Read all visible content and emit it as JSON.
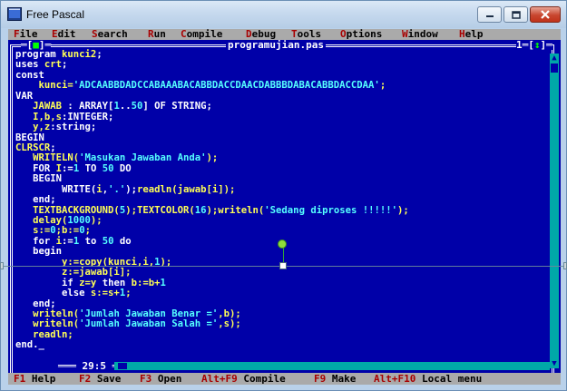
{
  "window": {
    "title": "Free Pascal",
    "icon": "free-pascal-icon",
    "colors": {
      "frame": "#b9d1ea",
      "desktop": "#0000a8",
      "menu": "#aaaaaa",
      "hotkey": "#a80000"
    }
  },
  "menu": [
    {
      "hot": "F",
      "rest": "ile"
    },
    {
      "hot": "E",
      "rest": "dit"
    },
    {
      "hot": "S",
      "rest": "earch"
    },
    {
      "hot": "R",
      "rest": "un"
    },
    {
      "hot": "C",
      "rest": "ompile"
    },
    {
      "hot": "D",
      "rest": "ebug"
    },
    {
      "hot": "T",
      "rest": "ools"
    },
    {
      "hot": "O",
      "rest": "ptions"
    },
    {
      "hot": "W",
      "rest": "indow"
    },
    {
      "hot": "H",
      "rest": "elp"
    }
  ],
  "editor": {
    "close_left": "═[",
    "close_mark": "■",
    "close_right": "]═",
    "filename": "programujian.pas",
    "window_number_left": "1═[",
    "window_number_mark": "↕",
    "window_number_right": "]═",
    "cursor_position": "29:5",
    "code": [
      [
        {
          "t": "program ",
          "c": "kw"
        },
        {
          "t": "kunci2",
          "c": "id"
        },
        {
          "t": ";",
          "c": "kw"
        }
      ],
      [
        {
          "t": "uses ",
          "c": "kw"
        },
        {
          "t": "crt",
          "c": "id"
        },
        {
          "t": ";",
          "c": "kw"
        }
      ],
      [
        {
          "t": "const",
          "c": "kw"
        }
      ],
      [
        {
          "t": "    kunci=",
          "c": "id"
        },
        {
          "t": "'ADCAABBDADCCABAAABACABBDACCDAACDABBBDABACABBDACCDAA'",
          "c": "str"
        },
        {
          "t": ";",
          "c": "id"
        }
      ],
      [
        {
          "t": "VAR",
          "c": "kw"
        }
      ],
      [
        {
          "t": "   JAWAB ",
          "c": "id"
        },
        {
          "t": ": ARRAY[",
          "c": "kw"
        },
        {
          "t": "1",
          "c": "num"
        },
        {
          "t": "..",
          "c": "kw"
        },
        {
          "t": "50",
          "c": "num"
        },
        {
          "t": "] OF STRING;",
          "c": "kw"
        }
      ],
      [
        {
          "t": "   I,b,s",
          "c": "id"
        },
        {
          "t": ":INTEGER;",
          "c": "kw"
        }
      ],
      [
        {
          "t": "   y,z",
          "c": "id"
        },
        {
          "t": ":string;",
          "c": "kw"
        }
      ],
      [
        {
          "t": "BEGIN",
          "c": "kw"
        }
      ],
      [
        {
          "t": "CLRSCR",
          "c": "id"
        },
        {
          "t": ";",
          "c": "kw"
        }
      ],
      [
        {
          "t": "   WRITELN(",
          "c": "id"
        },
        {
          "t": "'Masukan Jawaban Anda'",
          "c": "str"
        },
        {
          "t": ");",
          "c": "id"
        }
      ],
      [
        {
          "t": "   FOR ",
          "c": "kw"
        },
        {
          "t": "I",
          "c": "id"
        },
        {
          "t": ":=",
          "c": "kw"
        },
        {
          "t": "1",
          "c": "num"
        },
        {
          "t": " TO ",
          "c": "kw"
        },
        {
          "t": "50",
          "c": "num"
        },
        {
          "t": " DO",
          "c": "kw"
        }
      ],
      [
        {
          "t": "   BEGIN",
          "c": "kw"
        }
      ],
      [
        {
          "t": "        WRITE(",
          "c": "kw"
        },
        {
          "t": "i",
          "c": "id"
        },
        {
          "t": ",",
          "c": "kw"
        },
        {
          "t": "'.'",
          "c": "str"
        },
        {
          "t": ");",
          "c": "kw"
        },
        {
          "t": "readln(jawab[i]);",
          "c": "id"
        }
      ],
      [
        {
          "t": "   end;",
          "c": "kw"
        }
      ],
      [
        {
          "t": "   TEXTBACKGROUND(",
          "c": "id"
        },
        {
          "t": "5",
          "c": "num"
        },
        {
          "t": ");TEXTCOLOR(",
          "c": "id"
        },
        {
          "t": "16",
          "c": "num"
        },
        {
          "t": ");writeln(",
          "c": "id"
        },
        {
          "t": "'Sedang diproses !!!!!'",
          "c": "str"
        },
        {
          "t": ");",
          "c": "id"
        }
      ],
      [
        {
          "t": "   delay(",
          "c": "id"
        },
        {
          "t": "1000",
          "c": "num"
        },
        {
          "t": ");",
          "c": "id"
        }
      ],
      [
        {
          "t": "   s:=",
          "c": "id"
        },
        {
          "t": "0",
          "c": "num"
        },
        {
          "t": ";b:=",
          "c": "id"
        },
        {
          "t": "0",
          "c": "num"
        },
        {
          "t": ";",
          "c": "id"
        }
      ],
      [
        {
          "t": "   for ",
          "c": "kw"
        },
        {
          "t": "i",
          "c": "id"
        },
        {
          "t": ":=",
          "c": "kw"
        },
        {
          "t": "1",
          "c": "num"
        },
        {
          "t": " to ",
          "c": "kw"
        },
        {
          "t": "50",
          "c": "num"
        },
        {
          "t": " do",
          "c": "kw"
        }
      ],
      [
        {
          "t": "   begin",
          "c": "kw"
        }
      ],
      [
        {
          "t": "        y:=copy(kunci,i,",
          "c": "id"
        },
        {
          "t": "1",
          "c": "num"
        },
        {
          "t": ");",
          "c": "id"
        }
      ],
      [
        {
          "t": "        z:=jawab[i];",
          "c": "id"
        }
      ],
      [
        {
          "t": "        if ",
          "c": "kw"
        },
        {
          "t": "z=y",
          "c": "id"
        },
        {
          "t": " then ",
          "c": "kw"
        },
        {
          "t": "b:=b+",
          "c": "id"
        },
        {
          "t": "1",
          "c": "num"
        }
      ],
      [
        {
          "t": "        else ",
          "c": "kw"
        },
        {
          "t": "s:=s+",
          "c": "id"
        },
        {
          "t": "1",
          "c": "num"
        },
        {
          "t": ";",
          "c": "id"
        }
      ],
      [
        {
          "t": "   end;",
          "c": "kw"
        }
      ],
      [
        {
          "t": "   writeln(",
          "c": "id"
        },
        {
          "t": "'Jumlah Jawaban Benar ='",
          "c": "str"
        },
        {
          "t": ",b);",
          "c": "id"
        }
      ],
      [
        {
          "t": "   writeln(",
          "c": "id"
        },
        {
          "t": "'Jumlah Jawaban Salah ='",
          "c": "str"
        },
        {
          "t": ",s);",
          "c": "id"
        }
      ],
      [
        {
          "t": "   readln;",
          "c": "id"
        }
      ],
      [
        {
          "t": "end.",
          "c": "kw"
        },
        {
          "t": "_",
          "c": "kw"
        }
      ]
    ]
  },
  "status": [
    {
      "key": "F1",
      "label": " Help"
    },
    {
      "key": "F2",
      "label": " Save"
    },
    {
      "key": "F3",
      "label": " Open"
    },
    {
      "key": "Alt+F9",
      "label": " Compile"
    },
    {
      "key": "F9",
      "label": " Make"
    },
    {
      "key": "Alt+F10",
      "label": " Local menu"
    }
  ]
}
